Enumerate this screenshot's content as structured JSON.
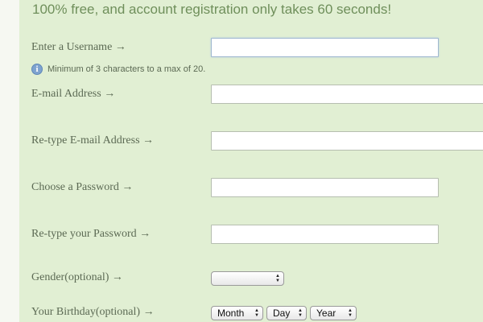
{
  "tagline": "100% free, and account registration only takes 60 seconds!",
  "form": {
    "username": {
      "label": "Enter a Username →",
      "value": ""
    },
    "username_hint": {
      "icon": "info-icon",
      "text": "Minimum of 3 characters to a max of 20."
    },
    "email": {
      "label": "E-mail Address →",
      "value": ""
    },
    "email_confirm": {
      "label": "Re-type E-mail Address →",
      "value": ""
    },
    "password": {
      "label": "Choose a Password →",
      "value": ""
    },
    "password_confirm": {
      "label": "Re-type your Password →",
      "value": ""
    },
    "gender": {
      "label": "Gender(optional) →",
      "selected": ""
    },
    "birthday": {
      "label": "Your Birthday(optional) →",
      "month": "Month",
      "day": "Day",
      "year": "Year"
    }
  },
  "colors": {
    "panel_background": "#e1efd3",
    "tagline": "#6f8f5b",
    "label_text": "#5c6a54",
    "info_icon": "#7ea3cf"
  }
}
